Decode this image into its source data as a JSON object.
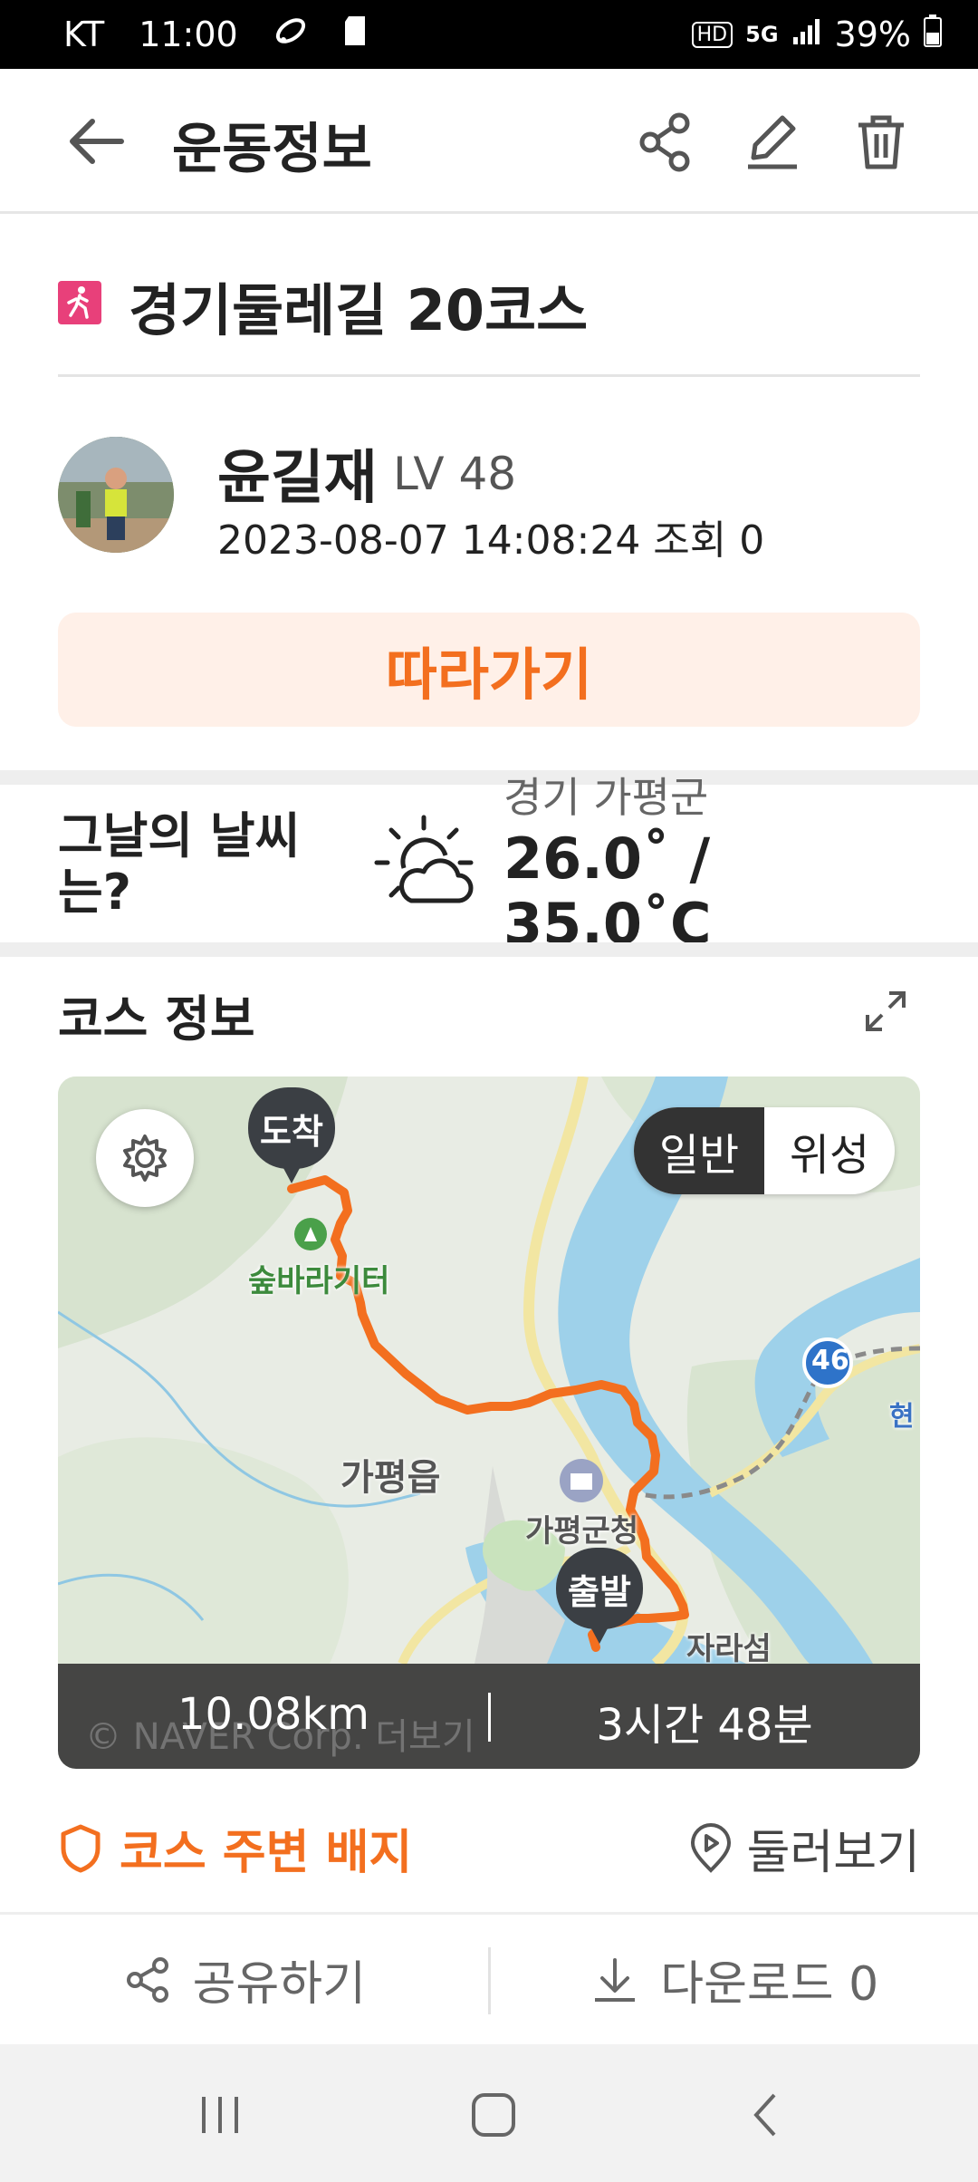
{
  "status_bar": {
    "carrier": "KT",
    "time": "11:00",
    "hd_badge": "HD",
    "network": "5G",
    "battery": "39%"
  },
  "app_bar": {
    "title": "운동정보",
    "icons": [
      "back-arrow-icon",
      "share-icon",
      "edit-icon",
      "trash-icon"
    ]
  },
  "course": {
    "title": "경기둘레길 20코스",
    "icon": "hiking-icon",
    "icon_color": "#e8407a"
  },
  "author": {
    "name": "윤길재",
    "level": "LV 48",
    "meta": "2023-08-07 14:08:24 조회 0"
  },
  "follow_button": {
    "label": "따라가기",
    "text_color": "#f36f1f",
    "bg_color": "#fff0e8"
  },
  "weather": {
    "label": "그날의 날씨는?",
    "region": "경기 가평군",
    "temp_line1": "26.0˚ /",
    "temp_line2": "35.0˚C",
    "icon": "partly-cloudy-sun-icon"
  },
  "course_info": {
    "title": "코스 정보",
    "map": {
      "toggle": {
        "normal": "일반",
        "satellite": "위성",
        "selected": "일반"
      },
      "markers": {
        "end": "도착",
        "start": "출발"
      },
      "labels": {
        "forest": "숲바라기터",
        "town": "가평읍",
        "office": "가평군청",
        "island": "자라섬",
        "route_num": "46",
        "edge": "현"
      },
      "route_color": "#f36f1f",
      "attribution": "© NAVER Corp. 더보기"
    },
    "distance": "10.08km",
    "duration": "3시간 48분"
  },
  "badge_row": {
    "badges_label": "코스 주변 배지",
    "look_around_label": "둘러보기"
  },
  "bottom_actions": {
    "share_label": "공유하기",
    "download_label": "다운로드 0"
  }
}
